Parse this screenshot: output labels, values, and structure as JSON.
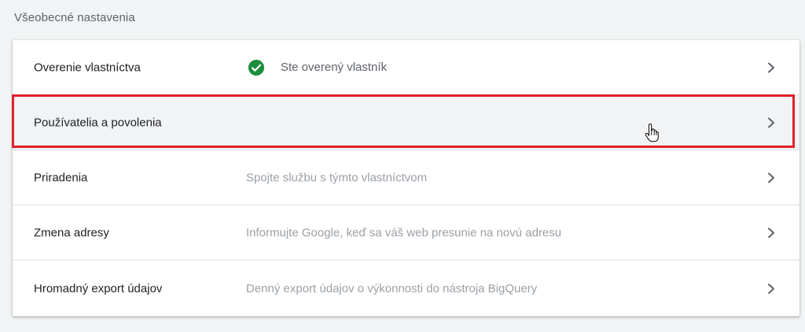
{
  "section": {
    "title": "Všeobecné nastavenia"
  },
  "settings": {
    "rows": [
      {
        "label": "Overenie vlastníctva",
        "status": "Ste overený vlastník",
        "icon": "check-circle-icon"
      },
      {
        "label": "Používatelia a povolenia",
        "description": ""
      },
      {
        "label": "Priradenia",
        "description": "Spojte službu s týmto vlastníctvom"
      },
      {
        "label": "Zmena adresy",
        "description": "Informujte Google, keď sa váš web presunie na novú adresu"
      },
      {
        "label": "Hromadný export údajov",
        "description": "Denný export údajov o výkonnosti do nástroja BigQuery"
      }
    ]
  },
  "colors": {
    "background": "#f1f3f4",
    "card": "#ffffff",
    "verified_green": "#1e8e3e",
    "highlight": "#e0202a"
  }
}
